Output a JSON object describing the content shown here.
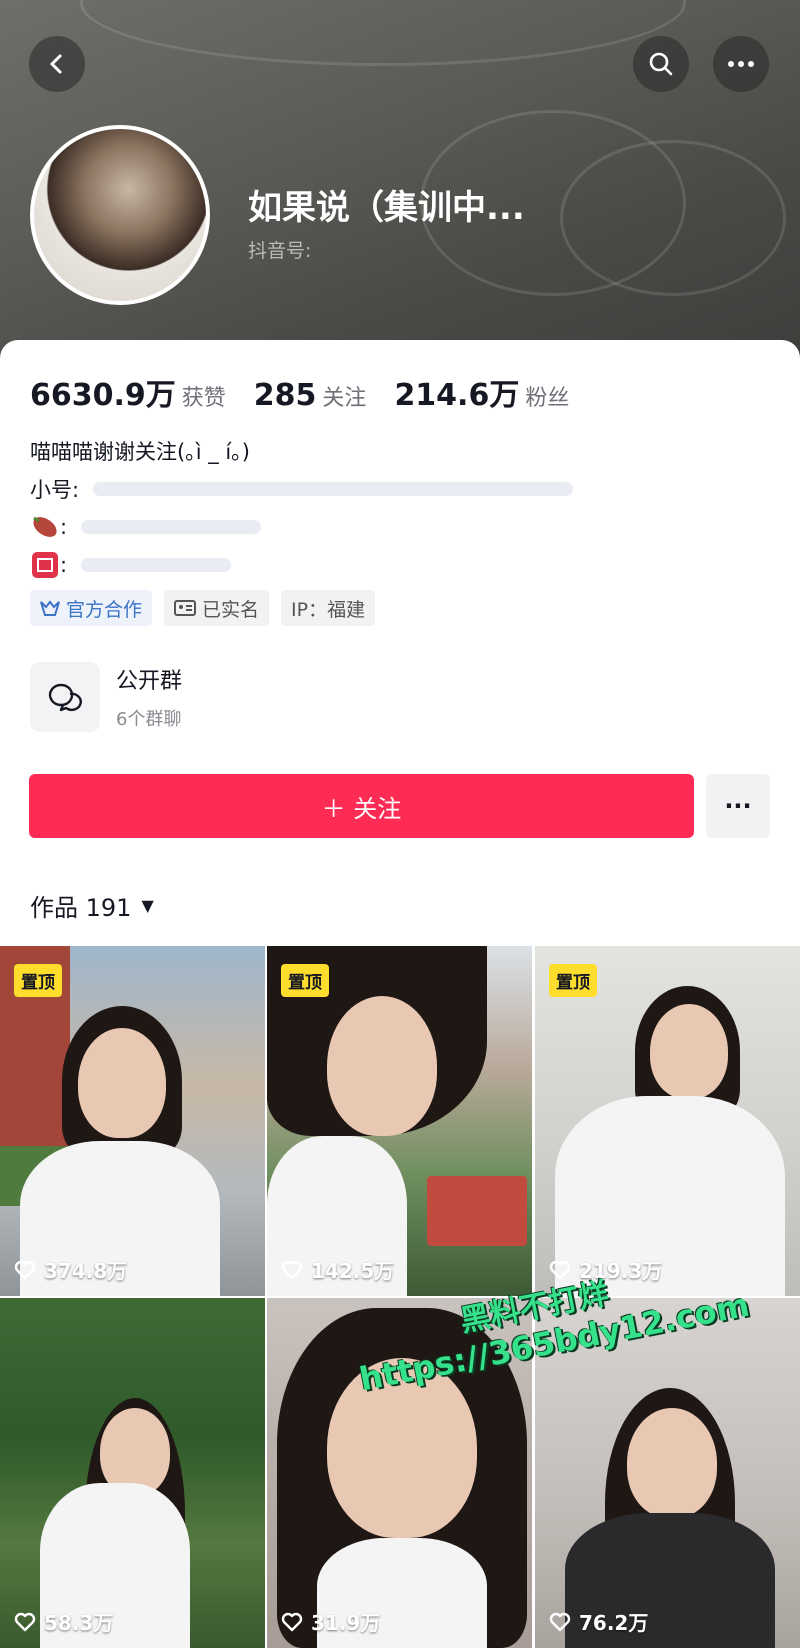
{
  "header": {
    "nickname": "如果说（集训中...",
    "douyin_id_label": "抖音号:",
    "back_icon": "back-arrow-icon",
    "search_icon": "search-icon",
    "more_icon": "more-icon"
  },
  "stats": [
    {
      "value": "6630.9万",
      "label": "获赞"
    },
    {
      "value": "285",
      "label": "关注"
    },
    {
      "value": "214.6万",
      "label": "粉丝"
    }
  ],
  "bio": {
    "line1": "喵喵喵谢谢关注(｡ì _ í｡)",
    "line2": "小号:",
    "line3": ":",
    "line4": ":"
  },
  "tags": [
    {
      "label": "官方合作",
      "icon": "official-cooperation-icon"
    },
    {
      "label": "已实名",
      "icon": "id-card-icon"
    },
    {
      "label": "IP：福建",
      "icon": ""
    }
  ],
  "group": {
    "title": "公开群",
    "subtitle": "6个群聊"
  },
  "actions": {
    "follow_label": "＋ 关注",
    "more_label": "···"
  },
  "works": {
    "label": "作品 191",
    "arrow": "▼"
  },
  "videos": [
    {
      "pinned": "置顶",
      "likes": "374.8万"
    },
    {
      "pinned": "置顶",
      "likes": "142.5万"
    },
    {
      "pinned": "置顶",
      "likes": "219.3万"
    },
    {
      "pinned": "",
      "likes": "58.3万"
    },
    {
      "pinned": "",
      "likes": "31.9万"
    },
    {
      "pinned": "",
      "likes": "76.2万"
    }
  ],
  "watermark": {
    "line1": "黑料不打烊",
    "line2": "https://365bdy12.com"
  },
  "colors": {
    "follow": "#fe2c55",
    "pin": "#ffdd2c",
    "watermark": "#35e28b"
  }
}
